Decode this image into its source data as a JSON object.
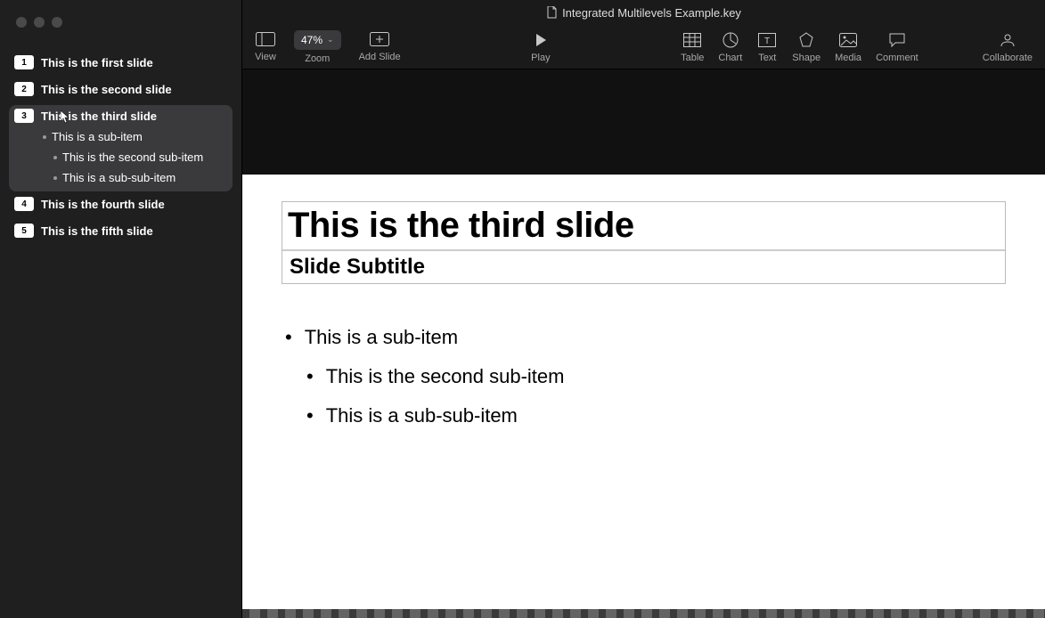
{
  "document": {
    "title": "Integrated Multilevels Example.key"
  },
  "toolbar": {
    "view": "View",
    "zoom_label": "Zoom",
    "zoom_value": "47%",
    "add_slide": "Add Slide",
    "play": "Play",
    "table": "Table",
    "chart": "Chart",
    "text": "Text",
    "shape": "Shape",
    "media": "Media",
    "comment": "Comment",
    "collaborate": "Collaborate"
  },
  "outline": {
    "slides": [
      {
        "num": "1",
        "title": "This is the first slide",
        "selected": false,
        "children": []
      },
      {
        "num": "2",
        "title": "This is the second slide",
        "selected": false,
        "children": []
      },
      {
        "num": "3",
        "title": "This is the third slide",
        "selected": true,
        "children": [
          {
            "text": "This is a sub-item",
            "indent": 1
          },
          {
            "text": "This is the second sub-item",
            "indent": 2
          },
          {
            "text": "This is a sub-sub-item",
            "indent": 2
          }
        ]
      },
      {
        "num": "4",
        "title": "This is the fourth slide",
        "selected": false,
        "children": []
      },
      {
        "num": "5",
        "title": "This is the fifth slide",
        "selected": false,
        "children": []
      }
    ]
  },
  "slide": {
    "title": "This is the third slide",
    "subtitle": "Slide Subtitle",
    "bullets": [
      {
        "text": "This is a sub-item",
        "level": 1
      },
      {
        "text": "This is the second sub-item",
        "level": 2
      },
      {
        "text": "This is a sub-sub-item",
        "level": 2
      }
    ]
  }
}
